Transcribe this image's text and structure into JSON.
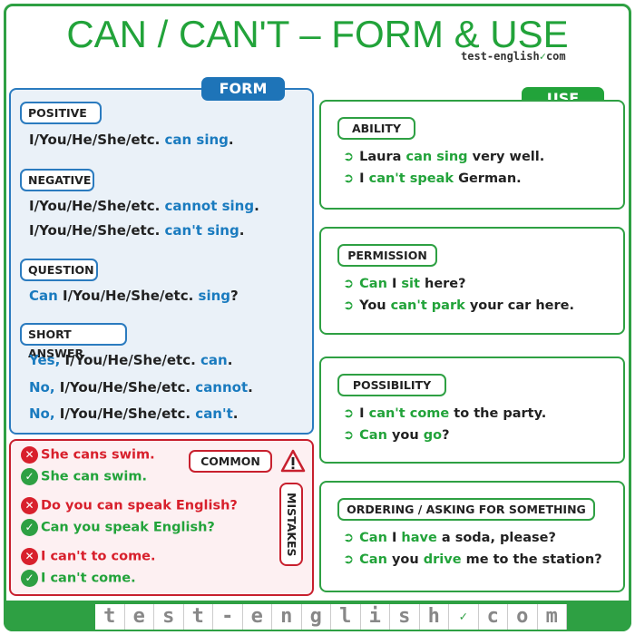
{
  "title": "CAN / CAN'T – FORM & USE",
  "site": {
    "left": "test-english",
    "right": "com"
  },
  "colors": {
    "green": "#22a33a",
    "blue": "#1e74b8",
    "red": "#c8202e"
  },
  "form": {
    "tab": "FORM",
    "sections": [
      {
        "label": "POSITIVE",
        "lines": [
          [
            {
              "t": "I/You/He/She/etc. "
            },
            {
              "t": "can sing",
              "hl": 1
            },
            {
              "t": "."
            }
          ]
        ]
      },
      {
        "label": "NEGATIVE",
        "lines": [
          [
            {
              "t": "I/You/He/She/etc. "
            },
            {
              "t": "cannot sing",
              "hl": 1
            },
            {
              "t": "."
            }
          ],
          [
            {
              "t": "I/You/He/She/etc. "
            },
            {
              "t": "can't sing",
              "hl": 1
            },
            {
              "t": "."
            }
          ]
        ]
      },
      {
        "label": "QUESTION",
        "lines": [
          [
            {
              "t": "Can",
              "hl": 1
            },
            {
              "t": " I/You/He/She/etc. "
            },
            {
              "t": "sing",
              "hl": 1
            },
            {
              "t": "?"
            }
          ]
        ]
      },
      {
        "label": "SHORT ANSWER",
        "lines": [
          [
            {
              "t": "Yes,",
              "hl": 1
            },
            {
              "t": " I/You/He/She/etc. "
            },
            {
              "t": "can",
              "hl": 1
            },
            {
              "t": "."
            }
          ],
          [
            {
              "t": "No,",
              "hl": 1
            },
            {
              "t": " I/You/He/She/etc. "
            },
            {
              "t": "cannot",
              "hl": 1
            },
            {
              "t": "."
            }
          ],
          [
            {
              "t": "No,",
              "hl": 1
            },
            {
              "t": " I/You/He/She/etc. "
            },
            {
              "t": "can't",
              "hl": 1
            },
            {
              "t": "."
            }
          ]
        ]
      }
    ]
  },
  "mistakes": {
    "label_common": "COMMON",
    "label_mistakes": "MISTAKES",
    "items": [
      {
        "wrong": "She cans swim.",
        "right": "She can swim."
      },
      {
        "wrong": "Do you can speak English?",
        "right": "Can you speak English?"
      },
      {
        "wrong": "I can't to come.",
        "right": "I can't come."
      }
    ]
  },
  "use": {
    "tab": "USE",
    "sections": [
      {
        "label": "ABILITY",
        "lines": [
          [
            {
              "t": "Laura "
            },
            {
              "t": "can sing",
              "hl": 1
            },
            {
              "t": " very well."
            }
          ],
          [
            {
              "t": "I "
            },
            {
              "t": "can't speak",
              "hl": 1
            },
            {
              "t": " German."
            }
          ]
        ]
      },
      {
        "label": "PERMISSION",
        "lines": [
          [
            {
              "t": "Can",
              "hl": 1
            },
            {
              "t": " I "
            },
            {
              "t": "sit",
              "hl": 1
            },
            {
              "t": " here?"
            }
          ],
          [
            {
              "t": "You "
            },
            {
              "t": "can't park",
              "hl": 1
            },
            {
              "t": " your car here."
            }
          ]
        ]
      },
      {
        "label": "POSSIBILITY",
        "lines": [
          [
            {
              "t": "I "
            },
            {
              "t": "can't come",
              "hl": 1
            },
            {
              "t": " to the party."
            }
          ],
          [
            {
              "t": "Can",
              "hl": 1
            },
            {
              "t": " you "
            },
            {
              "t": "go",
              "hl": 1
            },
            {
              "t": "?"
            }
          ]
        ]
      },
      {
        "label": "ORDERING / ASKING FOR SOMETHING",
        "lines": [
          [
            {
              "t": "Can",
              "hl": 1
            },
            {
              "t": " I "
            },
            {
              "t": "have",
              "hl": 1
            },
            {
              "t": " a soda, please?"
            }
          ],
          [
            {
              "t": "Can",
              "hl": 1
            },
            {
              "t": " you "
            },
            {
              "t": "drive",
              "hl": 1
            },
            {
              "t": " me to the station?"
            }
          ]
        ]
      }
    ]
  },
  "footer": {
    "tiles": [
      "t",
      "e",
      "s",
      "t",
      "-",
      "e",
      "n",
      "g",
      "l",
      "i",
      "s",
      "h",
      "✓",
      "c",
      "o",
      "m"
    ]
  }
}
